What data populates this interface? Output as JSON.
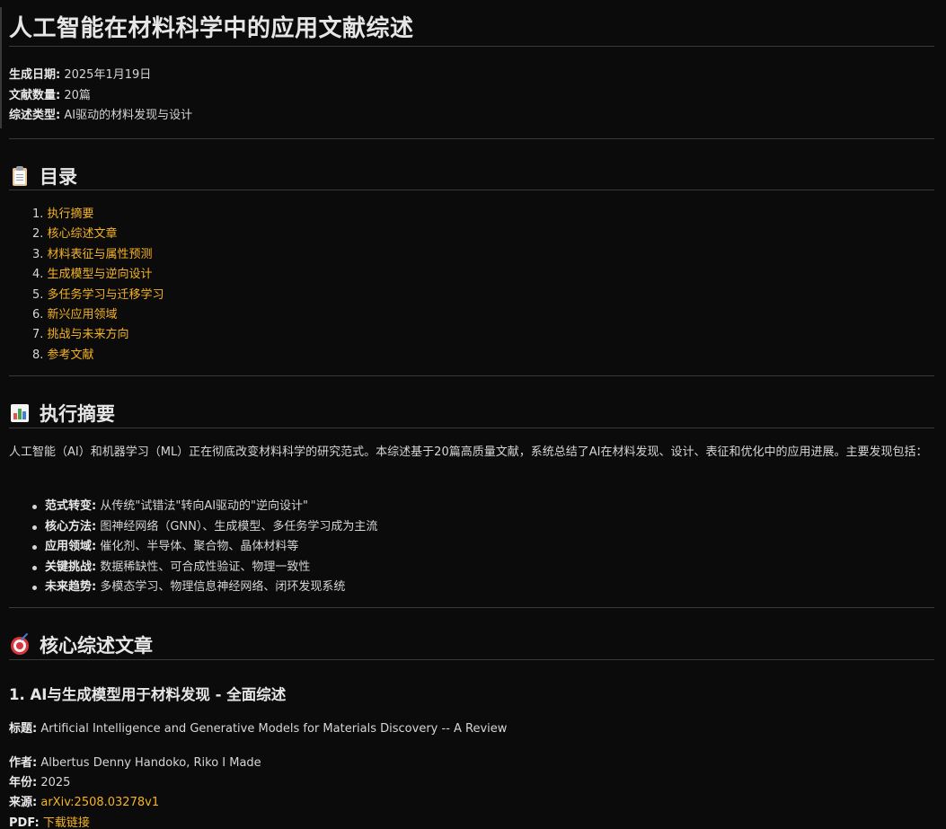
{
  "title": "人工智能在材料科学中的应用文献综述",
  "meta": [
    {
      "label": "生成日期",
      "value": "2025年1月19日"
    },
    {
      "label": "文献数量",
      "value": "20篇"
    },
    {
      "label": "综述类型",
      "value": "AI驱动的材料发现与设计"
    }
  ],
  "toc": {
    "heading": "目录",
    "icon": "clipboard-icon",
    "items": [
      {
        "num": "1.",
        "label": "执行摘要"
      },
      {
        "num": "2.",
        "label": "核心综述文章"
      },
      {
        "num": "3.",
        "label": "材料表征与属性预测"
      },
      {
        "num": "4.",
        "label": "生成模型与逆向设计"
      },
      {
        "num": "5.",
        "label": "多任务学习与迁移学习"
      },
      {
        "num": "6.",
        "label": "新兴应用领域"
      },
      {
        "num": "7.",
        "label": "挑战与未来方向"
      },
      {
        "num": "8.",
        "label": "参考文献"
      }
    ]
  },
  "summary": {
    "heading": "执行摘要",
    "icon": "bar-chart-icon",
    "intro": "人工智能（AI）和机器学习（ML）正在彻底改变材料科学的研究范式。本综述基于20篇高质量文献，系统总结了AI在材料发现、设计、表征和优化中的应用进展。主要发现包括：",
    "bullets": [
      {
        "label": "范式转变",
        "text": "从传统\"试错法\"转向AI驱动的\"逆向设计\""
      },
      {
        "label": "核心方法",
        "text": "图神经网络（GNN）、生成模型、多任务学习成为主流"
      },
      {
        "label": "应用领域",
        "text": "催化剂、半导体、聚合物、晶体材料等"
      },
      {
        "label": "关键挑战",
        "text": "数据稀缺性、可合成性验证、物理一致性"
      },
      {
        "label": "未来趋势",
        "text": "多模态学习、物理信息神经网络、闭环发现系统"
      }
    ]
  },
  "core": {
    "heading": "核心综述文章",
    "icon": "target-icon",
    "article": {
      "title": "1. AI与生成模型用于材料发现 - 全面综述",
      "subject_label": "标题",
      "subject": "Artificial Intelligence and Generative Models for Materials Discovery -- A Review",
      "authors_label": "作者",
      "authors": "Albertus Denny Handoko, Riko I Made",
      "year_label": "年份",
      "year": "2025",
      "source_label": "来源",
      "source": "arXiv:2508.03278v1",
      "pdf_label": "PDF",
      "pdf": "下载链接"
    }
  },
  "colors": {
    "background": "#0b0b0c",
    "text": "#d6d6d6",
    "link": "#f5b324",
    "rule": "#3a3a3a"
  }
}
